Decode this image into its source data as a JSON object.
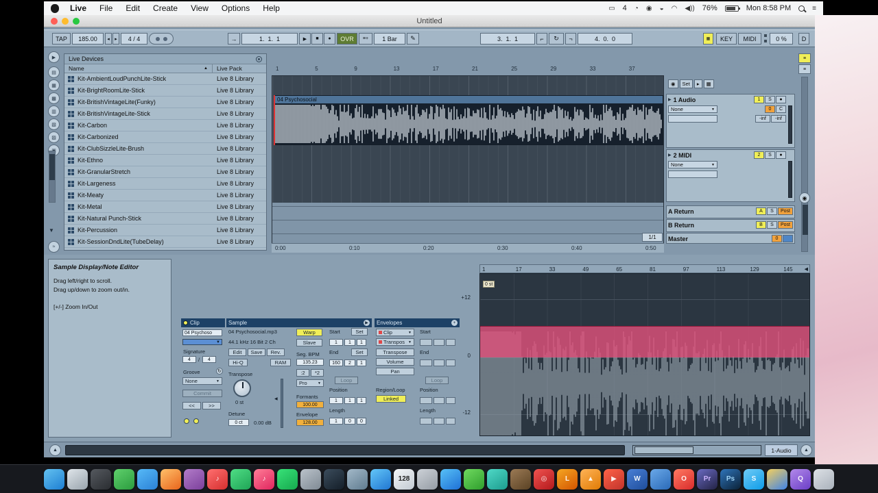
{
  "menubar": {
    "menus": [
      "Live",
      "File",
      "Edit",
      "Create",
      "View",
      "Options",
      "Help"
    ],
    "status": {
      "cast_count": "4",
      "battery": "76%",
      "clock": "Mon 8:58 PM"
    }
  },
  "window": {
    "title": "Untitled"
  },
  "transport": {
    "tap": "TAP",
    "tempo": "185.00",
    "signature": "4 / 4",
    "position": "1.  1.  1",
    "ovr": "OVR",
    "quantize": "1 Bar",
    "loop_start": "3.  1.  1",
    "loop_length": "4.  0.  0",
    "key": "KEY",
    "midi": "MIDI",
    "cpu": "0 %",
    "disk": "D"
  },
  "glyphs": {
    "play": "▶",
    "stop": "■",
    "record": "●",
    "follow": "→",
    "overdub": "≡+",
    "pencil": "✎",
    "punch_in": "⌐",
    "loop": "↻",
    "punch_out": "¬",
    "sort_asc": "▲",
    "fold": "▶",
    "dropdown": "▼",
    "scroll_up": "▲",
    "scroll_down": "▼",
    "wave": "≈",
    "nudge_left": "◂",
    "nudge_right": "▸",
    "marker": "◉",
    "next": "▸",
    "grid": "▦",
    "lines": "≡",
    "arm": "●",
    "vol_marker": "◀",
    "ruler_marker": "◀"
  },
  "rail_icons": [
    "▶",
    "▤",
    "▦",
    "▩",
    "▥",
    "▧",
    "▨",
    "▣"
  ],
  "browser": {
    "title": "Live Devices",
    "col_name": "Name",
    "col_pack": "Live Pack",
    "rows": [
      {
        "name": "Kit-AmbientLoudPunchLite-Stick",
        "pack": "Live 8 Library"
      },
      {
        "name": "Kit-BrightRoomLite-Stick",
        "pack": "Live 8 Library"
      },
      {
        "name": "Kit-BritishVintageLite(Funky)",
        "pack": "Live 8 Library"
      },
      {
        "name": "Kit-BritishVintageLite-Stick",
        "pack": "Live 8 Library"
      },
      {
        "name": "Kit-Carbon",
        "pack": "Live 8 Library"
      },
      {
        "name": "Kit-Carbonized",
        "pack": "Live 8 Library"
      },
      {
        "name": "Kit-ClubSizzleLite-Brush",
        "pack": "Live 8 Library"
      },
      {
        "name": "Kit-Ethno",
        "pack": "Live 8 Library"
      },
      {
        "name": "Kit-GranularStretch",
        "pack": "Live 8 Library"
      },
      {
        "name": "Kit-Largeness",
        "pack": "Live 8 Library"
      },
      {
        "name": "Kit-Meaty",
        "pack": "Live 8 Library"
      },
      {
        "name": "Kit-Metal",
        "pack": "Live 8 Library"
      },
      {
        "name": "Kit-Natural Punch-Stick",
        "pack": "Live 8 Library"
      },
      {
        "name": "Kit-Percussion",
        "pack": "Live 8 Library"
      },
      {
        "name": "Kit-SessionDndLite(TubeDelay)",
        "pack": "Live 8 Library"
      }
    ]
  },
  "arrangement": {
    "bar_numbers": [
      "1",
      "5",
      "9",
      "13",
      "17",
      "21",
      "25",
      "29",
      "33",
      "37"
    ],
    "time_labels": [
      "0:00",
      "0:10",
      "0:20",
      "0:30",
      "0:40",
      "0:50"
    ],
    "clip_name": "04 Psychosocial",
    "set_label": "Set",
    "loop_ratio": "1/1",
    "track_audio": {
      "name": "1 Audio",
      "num": "1",
      "solo": "S",
      "routing": "None",
      "volume": "0",
      "pan": "C",
      "meter_l": "-inf",
      "meter_r": "-inf"
    },
    "track_midi": {
      "name": "2 MIDI",
      "num": "2",
      "solo": "S",
      "routing": "None"
    },
    "track_return_a": {
      "name": "A Return",
      "num": "A",
      "solo": "S",
      "post": "Post"
    },
    "track_return_b": {
      "name": "B Return",
      "num": "B",
      "solo": "S",
      "post": "Post"
    },
    "track_master": {
      "name": "Master",
      "volume": "0"
    }
  },
  "info_view": {
    "title": "Sample Display/Note Editor",
    "line1": "Drag left/right to scroll.",
    "line2": "Drag up/down to zoom out/in.",
    "line3": "[+/-] Zoom In/Out"
  },
  "clip_box": {
    "title": "Clip",
    "name": "04 Psychoso",
    "signature_label": "Signature",
    "sig_num": "4",
    "sig_den": "4",
    "groove_label": "Groove",
    "groove": "None",
    "commit": "Commit",
    "nudge_back": "<<",
    "nudge_fwd": ">>"
  },
  "sample_box": {
    "title": "Sample",
    "file": "04 Psychosocial.mp3",
    "format": "44.1 kHz 16 Bit 2 Ch",
    "edit": "Edit",
    "save": "Save",
    "rev": "Rev.",
    "hiq": "Hi-Q",
    "ram": "RAM",
    "transpose_label": "Transpose",
    "transpose": "0 st",
    "detune_label": "Detune",
    "detune": "0 ct",
    "gain": "0.00 dB",
    "warp": "Warp",
    "slave": "Slave",
    "seg_bpm_label": "Seg. BPM",
    "seg_bpm": "135.23",
    "half": ":2",
    "dbl": "*2",
    "warp_mode": "Pro",
    "formants_label": "Formants",
    "formants": "100.00",
    "envelope_label": "Envelope",
    "envelope": "128.00",
    "start_label": "Start",
    "set": "Set",
    "start": [
      "1",
      "1",
      "1"
    ],
    "end_label": "End",
    "end": [
      "160",
      "2",
      "1"
    ],
    "loop": "Loop",
    "position_label": "Position",
    "position": [
      "1",
      "1",
      "1"
    ],
    "length_label": "Length",
    "length": [
      "1",
      "0",
      "0"
    ]
  },
  "env_box": {
    "title": "Envelopes",
    "device": "Clip",
    "parameter": "Transpos",
    "quick_transpose": "Transpose",
    "quick_volume": "Volume",
    "quick_pan": "Pan",
    "start_label": "Start",
    "end_label": "End",
    "loop": "Loop",
    "region_label": "Region/Loop",
    "linked": "Linked",
    "position_label": "Position",
    "length_label": "Length"
  },
  "editor": {
    "bar_numbers": [
      "1",
      "17",
      "33",
      "49",
      "65",
      "81",
      "97",
      "113",
      "129",
      "145"
    ],
    "scale_top": "+12",
    "scale_mid": "0",
    "scale_bottom": "-12",
    "value_tag": "0 st"
  },
  "status_bar": {
    "selected_track": "1-Audio"
  },
  "colors": {
    "accent_yellow": "#f0ee58",
    "accent_orange": "#f2a23c",
    "envelope_pink": "#de507a",
    "ovr_green": "#5e7c33"
  },
  "dock": [
    {
      "name": "finder",
      "c1": "#63c1f0",
      "c2": "#1d7ed2",
      "g": ""
    },
    {
      "name": "preview",
      "c1": "#dfe5ea",
      "c2": "#98a3ac",
      "g": ""
    },
    {
      "name": "mission-control",
      "c1": "#55595f",
      "c2": "#2a2d31",
      "g": ""
    },
    {
      "name": "photo-booth",
      "c1": "#5fd06c",
      "c2": "#2b9c3e",
      "g": ""
    },
    {
      "name": "messages",
      "c1": "#56b9f7",
      "c2": "#2b81d6",
      "g": ""
    },
    {
      "name": "firefox",
      "c1": "#ffc06a",
      "c2": "#e8641b",
      "g": ""
    },
    {
      "name": "purple-app",
      "c1": "#b27cc9",
      "c2": "#7b3f9b",
      "g": ""
    },
    {
      "name": "music",
      "c1": "#ff6f6f",
      "c2": "#d52f2f",
      "g": "♪"
    },
    {
      "name": "green-app",
      "c1": "#4fdd85",
      "c2": "#1fa456",
      "g": ""
    },
    {
      "name": "itunes",
      "c1": "#ff7e97",
      "c2": "#e0245e",
      "g": "♪"
    },
    {
      "name": "spotify",
      "c1": "#38e178",
      "c2": "#16a94e",
      "g": ""
    },
    {
      "name": "grey-app",
      "c1": "#bac2ca",
      "c2": "#7f8a94",
      "g": ""
    },
    {
      "name": "steam",
      "c1": "#3b4c5c",
      "c2": "#141e28",
      "g": ""
    },
    {
      "name": "drive",
      "c1": "#a2b8c8",
      "c2": "#607c90",
      "g": ""
    },
    {
      "name": "mail",
      "c1": "#63c6f8",
      "c2": "#2076d2",
      "g": ""
    },
    {
      "name": "calculator",
      "c1": "#f4f6f8",
      "c2": "#c2cad2",
      "g": "128",
      "tc": "#222"
    },
    {
      "name": "notes",
      "c1": "#ccd1d7",
      "c2": "#959ca4",
      "g": ""
    },
    {
      "name": "safari",
      "c1": "#57c0f6",
      "c2": "#1e70d6",
      "g": ""
    },
    {
      "name": "whatsapp",
      "c1": "#6fd95f",
      "c2": "#2f9e2d",
      "g": ""
    },
    {
      "name": "teal-app",
      "c1": "#4fd8c6",
      "c2": "#1c9c8e",
      "g": ""
    },
    {
      "name": "minecraft",
      "c1": "#9b7a55",
      "c2": "#5a4224",
      "g": ""
    },
    {
      "name": "target",
      "c1": "#ef5350",
      "c2": "#b3191c",
      "g": "◎"
    },
    {
      "name": "libreoffice",
      "c1": "#f5a623",
      "c2": "#d35400",
      "g": "L"
    },
    {
      "name": "vlc",
      "c1": "#ffb357",
      "c2": "#e07b04",
      "g": "▲"
    },
    {
      "name": "player",
      "c1": "#ff6348",
      "c2": "#c0332b",
      "g": "▶"
    },
    {
      "name": "word",
      "c1": "#4a80d6",
      "c2": "#1e4d9b",
      "g": "W"
    },
    {
      "name": "blue-app",
      "c1": "#6aa8e8",
      "c2": "#2a6ab8",
      "g": ""
    },
    {
      "name": "opera",
      "c1": "#ff7a63",
      "c2": "#d92b2b",
      "g": "O"
    },
    {
      "name": "premiere",
      "c1": "#6a6ac2",
      "c2": "#222244",
      "g": "Pr",
      "tc": "#cdb4fe"
    },
    {
      "name": "photoshop",
      "c1": "#2f74ba",
      "c2": "#0b2238",
      "g": "Ps",
      "tc": "#9fd4f7"
    },
    {
      "name": "skype",
      "c1": "#6fcbf6",
      "c2": "#0d9ce8",
      "g": "S"
    },
    {
      "name": "chrome",
      "c1": "#f3cf5e",
      "c2": "#3f83e8",
      "g": ""
    },
    {
      "name": "quicktime",
      "c1": "#b289ea",
      "c2": "#6a3ec6",
      "g": "Q"
    },
    {
      "name": "trash",
      "c1": "#dde1e6",
      "c2": "#a9b1bb",
      "g": ""
    }
  ]
}
